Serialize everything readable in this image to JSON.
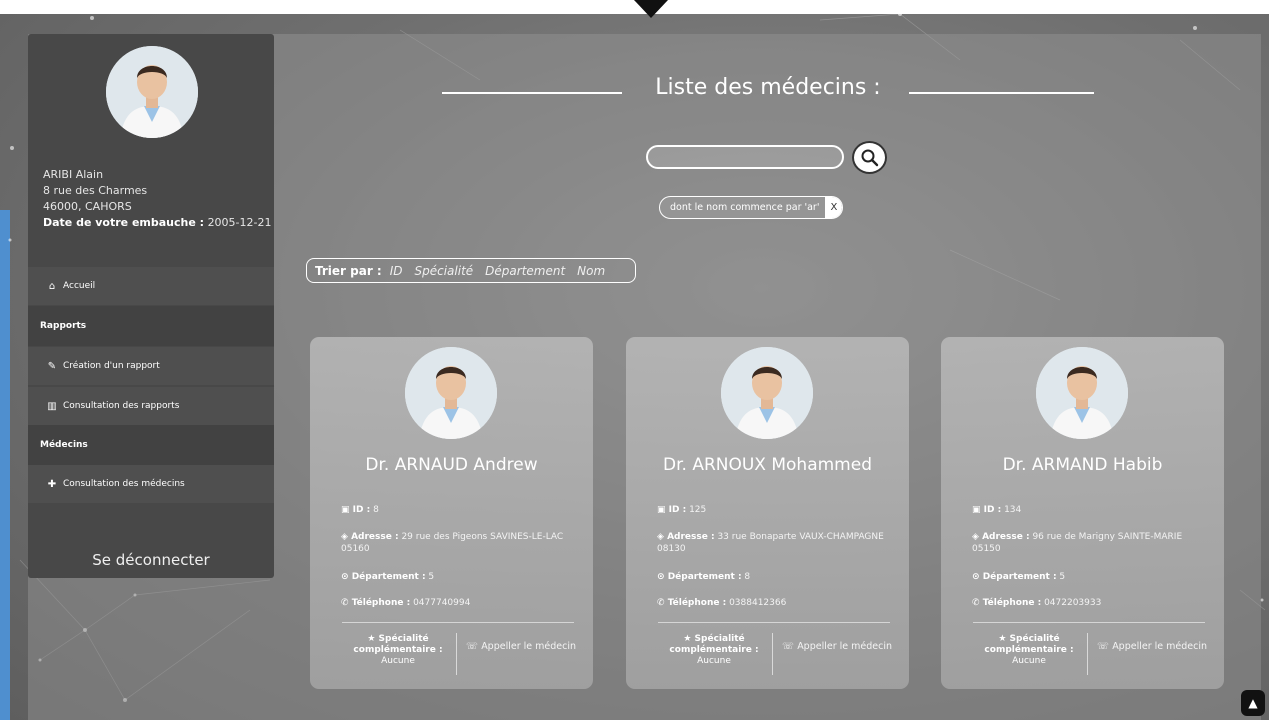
{
  "user": {
    "name": "ARIBI Alain",
    "address_line1": "8 rue des Charmes",
    "address_line2": "46000, CAHORS",
    "hire_label": "Date de votre embauche :",
    "hire_date": "2005-12-21"
  },
  "sidebar": {
    "home": "Accueil",
    "section_reports": "Rapports",
    "create_report": "Création d'un rapport",
    "view_reports": "Consultation des rapports",
    "section_doctors": "Médecins",
    "view_doctors": "Consultation des médecins",
    "logout": "Se déconnecter"
  },
  "main": {
    "title": "Liste des médecins :",
    "search": {
      "value": "",
      "placeholder": ""
    },
    "filter_text": "dont le nom commence par 'ar'",
    "filter_clear": "X",
    "sort_label": "Trier par :",
    "sort_options": [
      "ID",
      "Spécialité",
      "Département",
      "Nom"
    ]
  },
  "labels": {
    "id": "ID :",
    "address": "Adresse :",
    "department": "Département :",
    "phone": "Téléphone :",
    "specialty": "Spécialité complémentaire :",
    "call": "Appeller le médecin"
  },
  "doctors": [
    {
      "name": "Dr. ARNAUD Andrew",
      "id": "8",
      "address": "29 rue des Pigeons SAVINES-LE-LAC 05160",
      "department": "5",
      "phone": "0477740994",
      "specialty": "Aucune"
    },
    {
      "name": "Dr. ARNOUX Mohammed",
      "id": "125",
      "address": "33 rue Bonaparte VAUX-CHAMPAGNE 08130",
      "department": "8",
      "phone": "0388412366",
      "specialty": "Aucune"
    },
    {
      "name": "Dr. ARMAND Habib",
      "id": "134",
      "address": "96 rue de Marigny SAINTE-MARIE 05150",
      "department": "5",
      "phone": "0472203933",
      "specialty": "Aucune"
    }
  ],
  "icons": {
    "home": "home-icon",
    "create": "report-icon",
    "view": "book-icon",
    "add": "plus-icon",
    "search": "search-icon",
    "id": "id-card-icon",
    "address": "map-marker-icon",
    "department": "location-pin-icon",
    "phone": "phone-icon",
    "star": "star-icon",
    "call": "phone-call-icon",
    "scroll": "arrow-up-icon"
  },
  "colors": {
    "background": "#6f6f6f",
    "sidebar": "#484848",
    "accent_left": "#4f8fcf"
  }
}
